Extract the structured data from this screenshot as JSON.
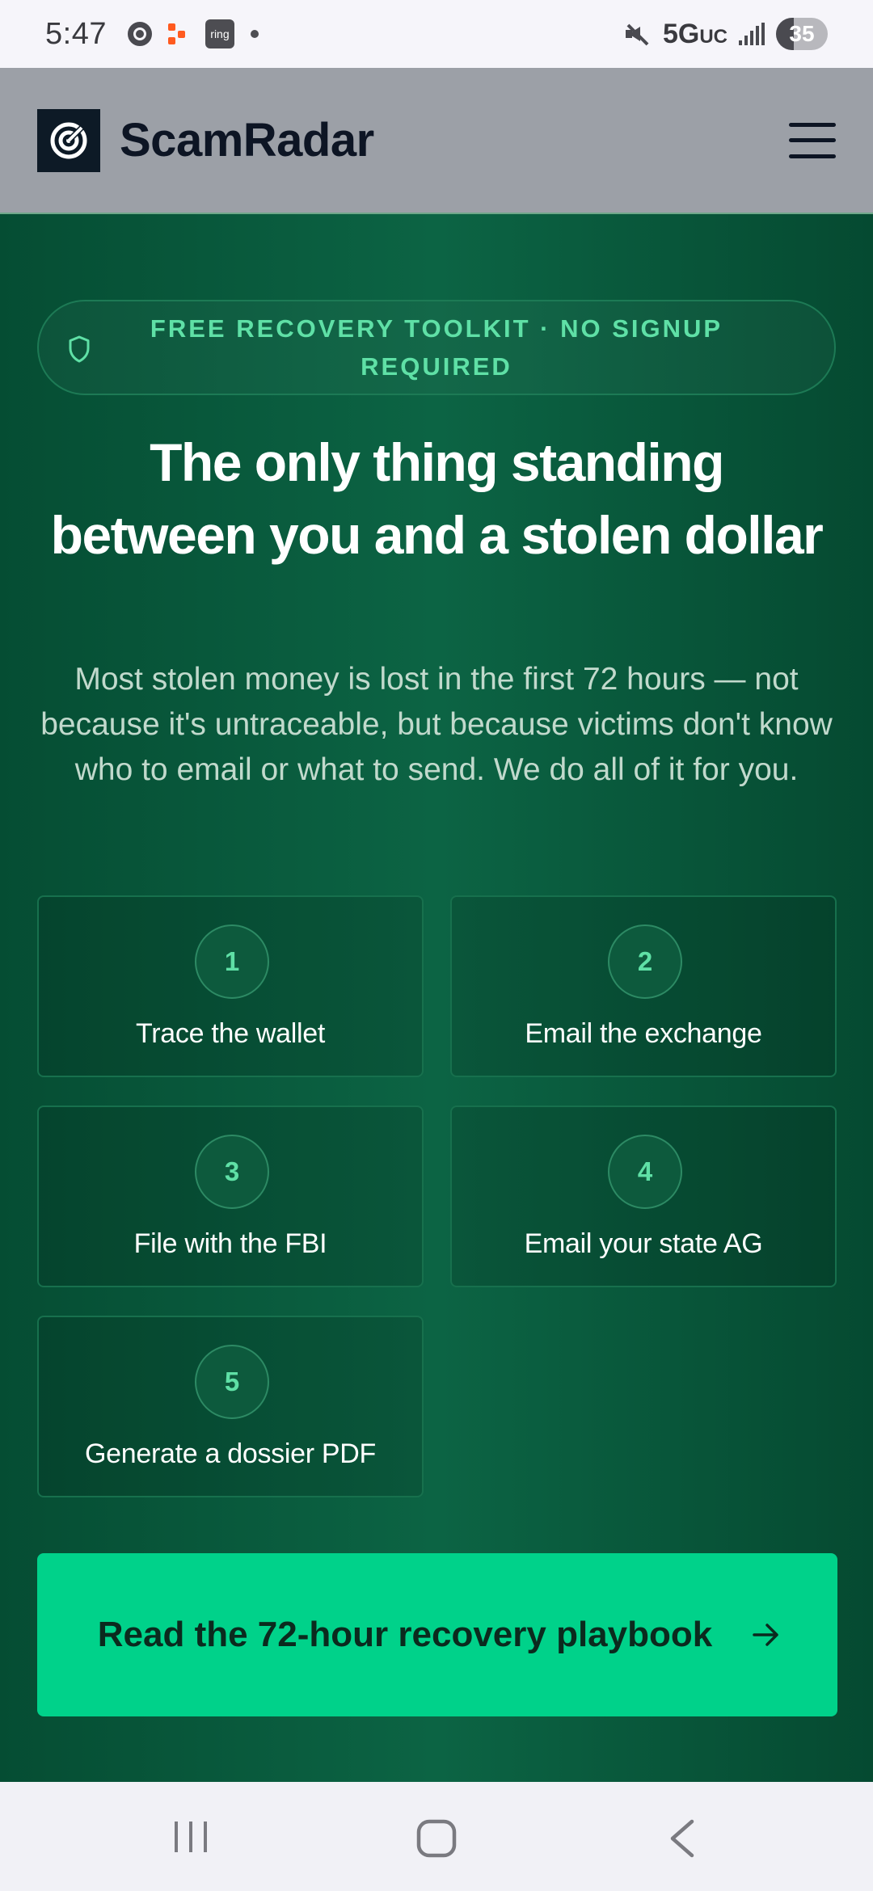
{
  "status_bar": {
    "time": "5:47",
    "ring_icon_text": "ring",
    "network": "5G",
    "network_sub": "UC",
    "battery": "35",
    "battery_level": 0.35,
    "icons": [
      "chrome-icon",
      "notification-dots-icon",
      "ring-app-icon",
      "dot-icon",
      "mute-icon",
      "signal-icon",
      "battery-icon"
    ]
  },
  "header": {
    "brand": "ScamRadar",
    "logo_icon": "radar-icon",
    "menu_icon": "hamburger-menu-icon"
  },
  "hero": {
    "badge": "FREE RECOVERY TOOLKIT · NO SIGNUP REQUIRED",
    "badge_icon": "shield-icon",
    "title": "The only thing standing between you and a stolen dollar",
    "subtitle": "Most stolen money is lost in the first 72 hours — not because it's untraceable, but because victims don't know who to email or what to send. We do all of it for you.",
    "steps": [
      {
        "number": "1",
        "label": "Trace the wallet"
      },
      {
        "number": "2",
        "label": "Email the exchange"
      },
      {
        "number": "3",
        "label": "File with the FBI"
      },
      {
        "number": "4",
        "label": "Email your state AG"
      },
      {
        "number": "5",
        "label": "Generate a dossier PDF"
      }
    ],
    "cta": "Read the 72-hour recovery playbook",
    "cta_icon": "arrow-right-icon"
  },
  "nav_bar": {
    "icons": [
      "recent-apps-icon",
      "home-icon",
      "back-icon"
    ]
  },
  "colors": {
    "hero_bg": "#0a5c3e",
    "accent": "#00d28a",
    "badge_text": "#5fe0a6",
    "header_bg": "#9ca0a7"
  }
}
